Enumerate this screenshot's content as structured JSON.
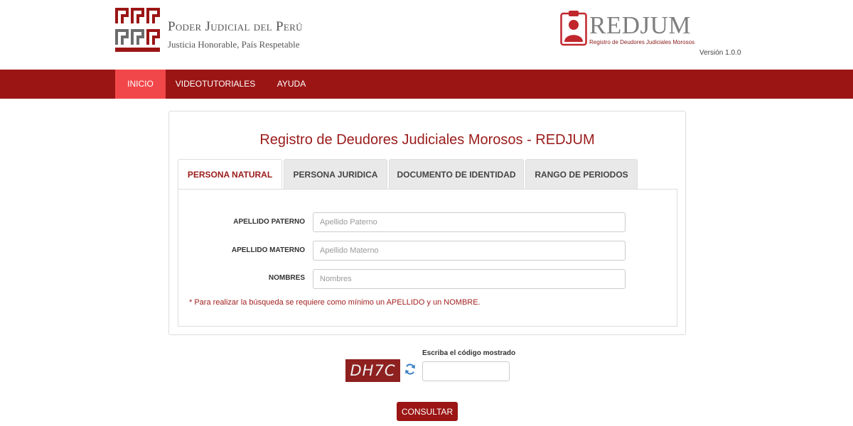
{
  "header": {
    "org_title": "Poder Judicial del Perú",
    "org_subtitle": "Justicia Honorable, País Respetable",
    "app_title": "REDJUM",
    "app_subtitle": "Registro de Deudores Judiciales Morosos",
    "version": "Versión 1.0.0",
    "brand_color": "#9b1515",
    "logo_icon": "poder-judicial-logo",
    "app_icon": "person-clipboard-icon"
  },
  "nav": {
    "items": [
      {
        "label": "INICIO",
        "active": true
      },
      {
        "label": "VIDEOTUTORIALES",
        "active": false
      },
      {
        "label": "AYUDA",
        "active": false
      }
    ],
    "active_color": "#f2474a"
  },
  "main": {
    "title": "Registro de Deudores Judiciales Morosos - REDJUM",
    "tabs": [
      {
        "label": "PERSONA NATURAL",
        "active": true
      },
      {
        "label": "PERSONA JURIDICA",
        "active": false
      },
      {
        "label": "DOCUMENTO DE IDENTIDAD",
        "active": false
      },
      {
        "label": "RANGO DE PERIODOS",
        "active": false
      }
    ],
    "fields": [
      {
        "label": "APELLIDO PATERNO",
        "placeholder": "Apellido Paterno",
        "value": ""
      },
      {
        "label": "APELLIDO MATERNO",
        "placeholder": "Apellido Materno",
        "value": ""
      },
      {
        "label": "NOMBRES",
        "placeholder": "Nombres",
        "value": ""
      }
    ],
    "note": "* Para realizar la búsqueda se requiere como mínimo un APELLIDO y un NOMBRE."
  },
  "captcha": {
    "code": "DH7C",
    "label": "Escriba el código mostrado",
    "value": "",
    "refresh_icon": "refresh-icon"
  },
  "submit": {
    "label": "CONSULTAR"
  }
}
